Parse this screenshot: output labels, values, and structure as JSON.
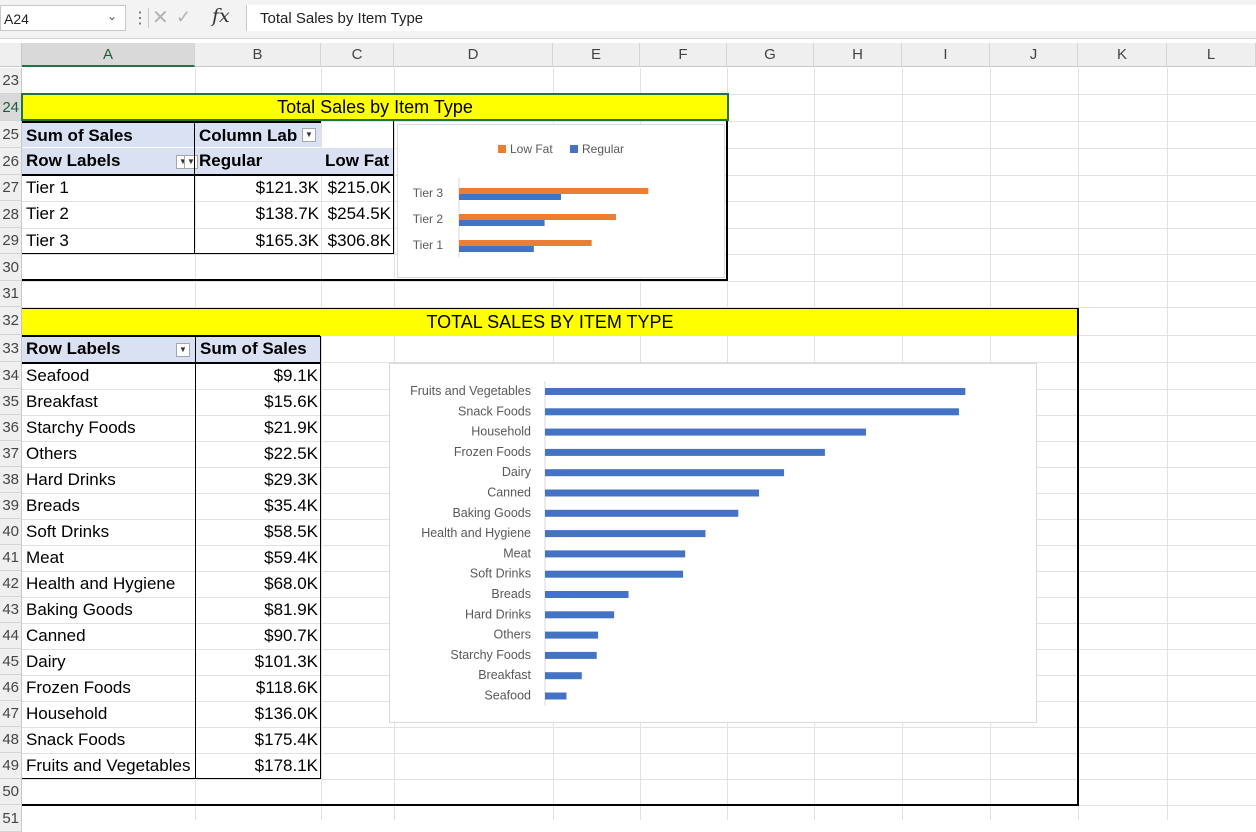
{
  "formula_bar": {
    "name_box": "A24",
    "formula": "Total Sales by Item Type",
    "fx_label": "fx",
    "cancel_glyph": "✕",
    "enter_glyph": "✓"
  },
  "columns": [
    "A",
    "B",
    "C",
    "D",
    "E",
    "F",
    "G",
    "H",
    "I",
    "J",
    "K",
    "L"
  ],
  "rows": [
    "23",
    "24",
    "25",
    "26",
    "27",
    "28",
    "29",
    "30",
    "31",
    "32",
    "33",
    "34",
    "35",
    "36",
    "37",
    "38",
    "39",
    "40",
    "41",
    "42",
    "43",
    "44",
    "45",
    "46",
    "47",
    "48",
    "49",
    "50",
    "51"
  ],
  "pivot1": {
    "banner": "Total Sales by Item Type",
    "values_label": "Sum of Sales",
    "column_labels": "Column Lab",
    "row_labels": "Row Labels",
    "columns": [
      "Regular",
      "Low Fat"
    ],
    "rows": [
      {
        "label": "Tier 1",
        "regular": "$121.3K",
        "lowfat": "$215.0K"
      },
      {
        "label": "Tier 2",
        "regular": "$138.7K",
        "lowfat": "$254.5K"
      },
      {
        "label": "Tier 3",
        "regular": "$165.3K",
        "lowfat": "$306.8K"
      }
    ]
  },
  "pivot2": {
    "banner": "TOTAL SALES BY ITEM TYPE",
    "row_labels": "Row Labels",
    "values_label": "Sum of Sales",
    "rows": [
      {
        "label": "Seafood",
        "value": "$9.1K"
      },
      {
        "label": "Breakfast",
        "value": "$15.6K"
      },
      {
        "label": "Starchy Foods",
        "value": "$21.9K"
      },
      {
        "label": "Others",
        "value": "$22.5K"
      },
      {
        "label": "Hard Drinks",
        "value": "$29.3K"
      },
      {
        "label": "Breads",
        "value": "$35.4K"
      },
      {
        "label": "Soft Drinks",
        "value": "$58.5K"
      },
      {
        "label": "Meat",
        "value": "$59.4K"
      },
      {
        "label": "Health and Hygiene",
        "value": "$68.0K"
      },
      {
        "label": "Baking Goods",
        "value": "$81.9K"
      },
      {
        "label": "Canned",
        "value": "$90.7K"
      },
      {
        "label": "Dairy",
        "value": "$101.3K"
      },
      {
        "label": "Frozen Foods",
        "value": "$118.6K"
      },
      {
        "label": "Household",
        "value": "$136.0K"
      },
      {
        "label": "Snack Foods",
        "value": "$175.4K"
      },
      {
        "label": "Fruits and Vegetables",
        "value": "$178.1K"
      }
    ]
  },
  "chart_data": [
    {
      "type": "bar",
      "orientation": "horizontal",
      "title": "",
      "categories": [
        "Tier 1",
        "Tier 2",
        "Tier 3"
      ],
      "series": [
        {
          "name": "Low Fat",
          "color": "#ed7d31",
          "values": [
            215.0,
            254.5,
            306.8
          ]
        },
        {
          "name": "Regular",
          "color": "#4472c4",
          "values": [
            121.3,
            138.7,
            165.3
          ]
        }
      ],
      "legend": "top",
      "xlim": [
        0,
        400
      ],
      "grid": false,
      "axis_labels_visible": false
    },
    {
      "type": "bar",
      "orientation": "horizontal",
      "title": "",
      "categories": [
        "Seafood",
        "Breakfast",
        "Starchy Foods",
        "Others",
        "Hard Drinks",
        "Breads",
        "Soft Drinks",
        "Meat",
        "Health and Hygiene",
        "Baking Goods",
        "Canned",
        "Dairy",
        "Frozen Foods",
        "Household",
        "Snack Foods",
        "Fruits and Vegetables"
      ],
      "series": [
        {
          "color": "#4472c4",
          "values": [
            9.1,
            15.6,
            21.9,
            22.5,
            29.3,
            35.4,
            58.5,
            59.4,
            68.0,
            81.9,
            90.7,
            101.3,
            118.6,
            136.0,
            175.4,
            178.1
          ]
        }
      ],
      "legend": "none",
      "grid": false,
      "axis_labels_visible": false
    }
  ]
}
